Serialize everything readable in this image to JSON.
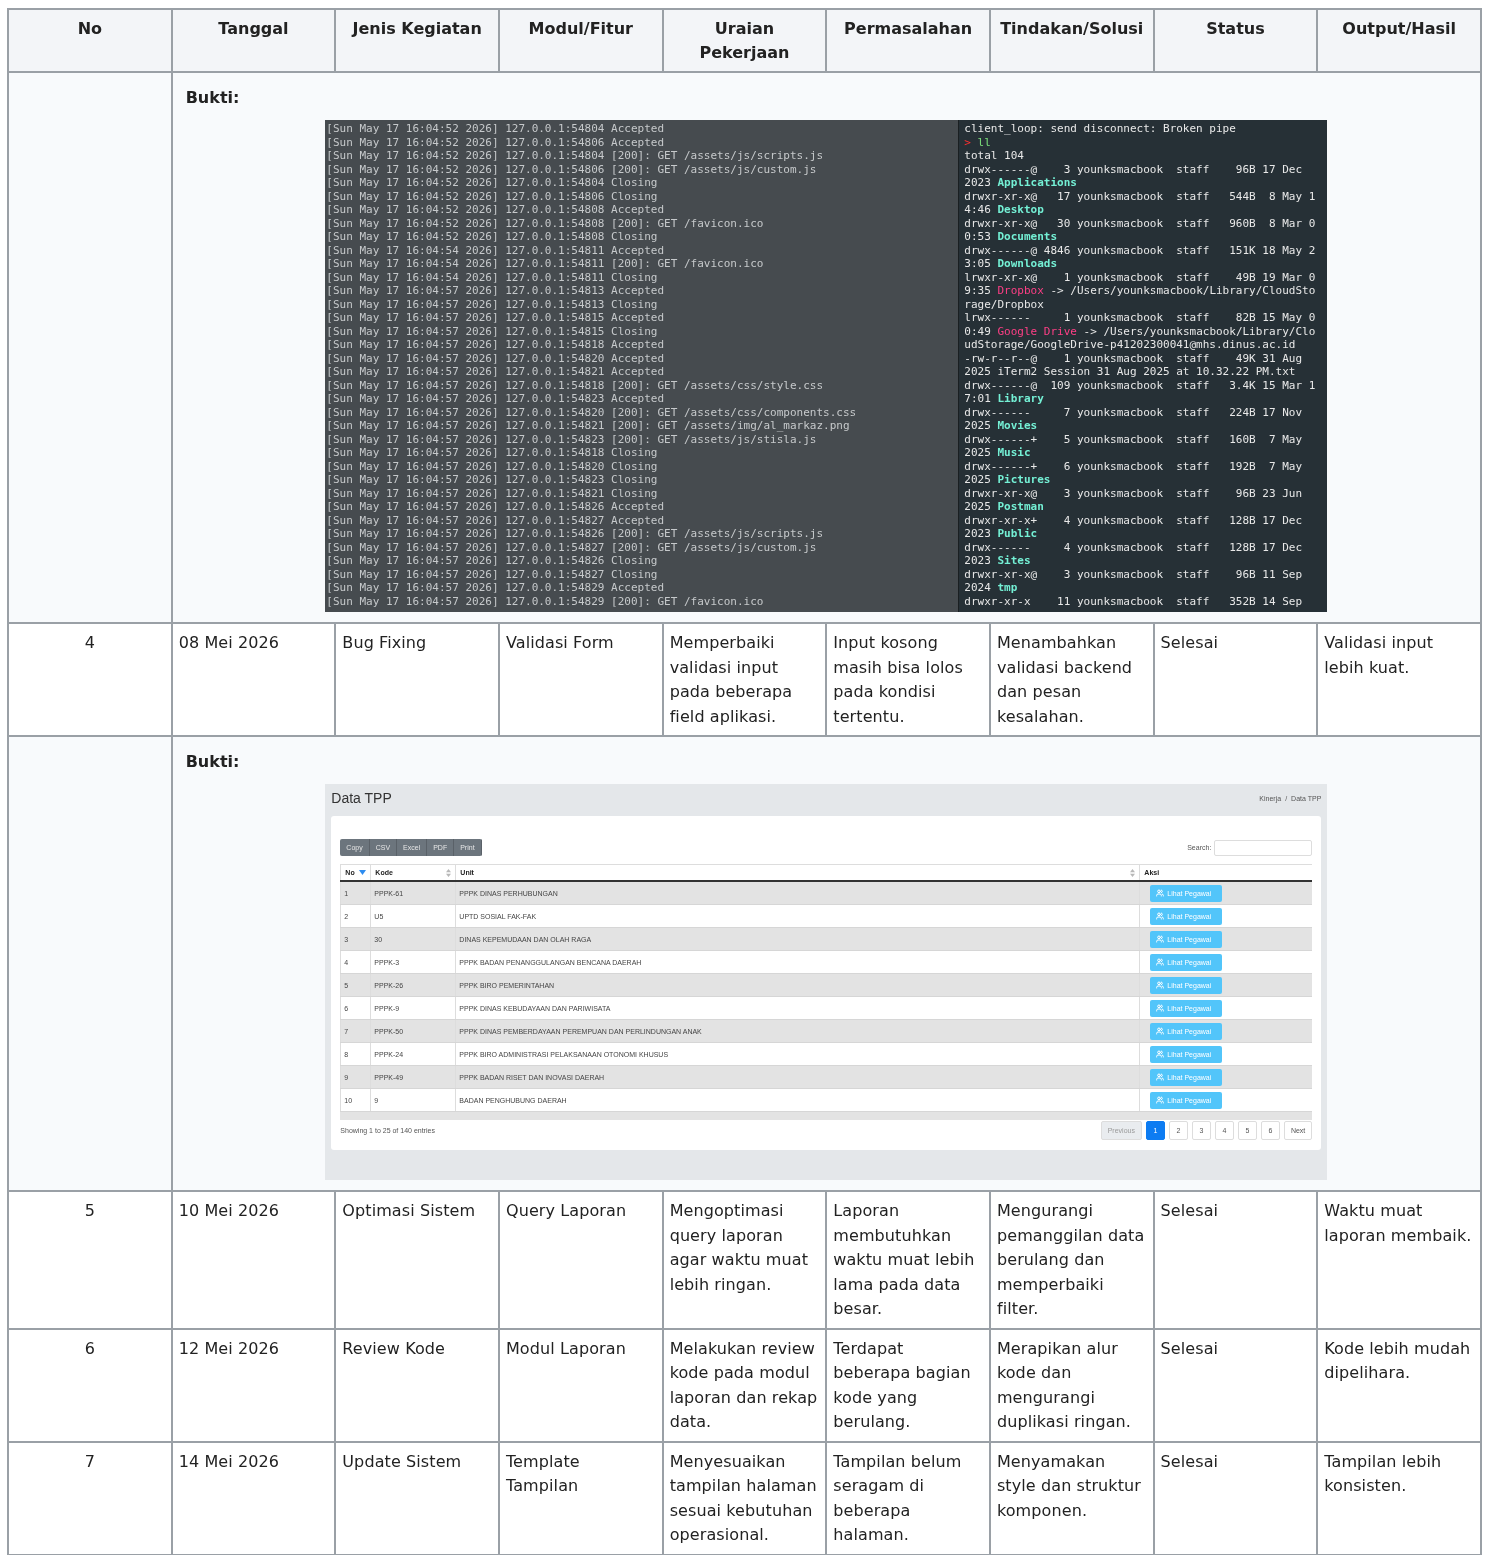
{
  "table": {
    "columns": [
      "No",
      "Tanggal",
      "Jenis Kegiatan",
      "Modul/Fitur",
      "Uraian Pekerjaan",
      "Permasalahan",
      "Tindakan/Solusi",
      "Status",
      "Output/Hasil"
    ],
    "rows": [
      {
        "kind": "evidence",
        "label": "Bukti:",
        "screenshot": {
          "kind": "terminal",
          "left_lines": [
            "[Sun May 17 16:04:52 2026] 127.0.0.1:54804 Accepted",
            "[Sun May 17 16:04:52 2026] 127.0.0.1:54806 Accepted",
            "[Sun May 17 16:04:52 2026] 127.0.0.1:54804 [200]: GET /assets/js/scripts.js",
            "[Sun May 17 16:04:52 2026] 127.0.0.1:54806 [200]: GET /assets/js/custom.js",
            "[Sun May 17 16:04:52 2026] 127.0.0.1:54804 Closing",
            "[Sun May 17 16:04:52 2026] 127.0.0.1:54806 Closing",
            "[Sun May 17 16:04:52 2026] 127.0.0.1:54808 Accepted",
            "[Sun May 17 16:04:52 2026] 127.0.0.1:54808 [200]: GET /favicon.ico",
            "[Sun May 17 16:04:52 2026] 127.0.0.1:54808 Closing",
            "[Sun May 17 16:04:54 2026] 127.0.0.1:54811 Accepted",
            "[Sun May 17 16:04:54 2026] 127.0.0.1:54811 [200]: GET /favicon.ico",
            "[Sun May 17 16:04:54 2026] 127.0.0.1:54811 Closing",
            "[Sun May 17 16:04:57 2026] 127.0.0.1:54813 Accepted",
            "[Sun May 17 16:04:57 2026] 127.0.0.1:54813 Closing",
            "[Sun May 17 16:04:57 2026] 127.0.0.1:54815 Accepted",
            "[Sun May 17 16:04:57 2026] 127.0.0.1:54815 Closing",
            "[Sun May 17 16:04:57 2026] 127.0.0.1:54818 Accepted",
            "[Sun May 17 16:04:57 2026] 127.0.0.1:54820 Accepted",
            "[Sun May 17 16:04:57 2026] 127.0.0.1:54821 Accepted",
            "[Sun May 17 16:04:57 2026] 127.0.0.1:54818 [200]: GET /assets/css/style.css",
            "[Sun May 17 16:04:57 2026] 127.0.0.1:54823 Accepted",
            "[Sun May 17 16:04:57 2026] 127.0.0.1:54820 [200]: GET /assets/css/components.css",
            "[Sun May 17 16:04:57 2026] 127.0.0.1:54821 [200]: GET /assets/img/al_markaz.png",
            "[Sun May 17 16:04:57 2026] 127.0.0.1:54823 [200]: GET /assets/js/stisla.js",
            "[Sun May 17 16:04:57 2026] 127.0.0.1:54818 Closing",
            "[Sun May 17 16:04:57 2026] 127.0.0.1:54820 Closing",
            "[Sun May 17 16:04:57 2026] 127.0.0.1:54823 Closing",
            "[Sun May 17 16:04:57 2026] 127.0.0.1:54821 Closing",
            "[Sun May 17 16:04:57 2026] 127.0.0.1:54826 Accepted",
            "[Sun May 17 16:04:57 2026] 127.0.0.1:54827 Accepted",
            "[Sun May 17 16:04:57 2026] 127.0.0.1:54826 [200]: GET /assets/js/scripts.js",
            "[Sun May 17 16:04:57 2026] 127.0.0.1:54827 [200]: GET /assets/js/custom.js",
            "[Sun May 17 16:04:57 2026] 127.0.0.1:54826 Closing",
            "[Sun May 17 16:04:57 2026] 127.0.0.1:54827 Closing",
            "[Sun May 17 16:04:57 2026] 127.0.0.1:54829 Accepted",
            "[Sun May 17 16:04:57 2026] 127.0.0.1:54829 [200]: GET /favicon.ico"
          ],
          "right_lines": [
            [
              {
                "text": "client_loop: send disconnect: Broken pipe",
                "kind": "plain"
              }
            ],
            [
              {
                "text": "> ",
                "kind": "prompt"
              },
              {
                "text": "ll",
                "kind": "command"
              }
            ],
            [
              {
                "text": "total 104",
                "kind": "plain"
              }
            ],
            [
              {
                "text": "drwx------@    3 younksmacbook  staff    96B 17 Dec",
                "kind": "plain"
              }
            ],
            [
              {
                "text": "2023 ",
                "kind": "plain"
              },
              {
                "text": "Applications",
                "kind": "dir"
              }
            ],
            [
              {
                "text": "drwxr-xr-x@   17 younksmacbook  staff   544B  8 May 1",
                "kind": "plain"
              }
            ],
            [
              {
                "text": "4:46 ",
                "kind": "plain"
              },
              {
                "text": "Desktop",
                "kind": "dir"
              }
            ],
            [
              {
                "text": "drwxr-xr-x@   30 younksmacbook  staff   960B  8 Mar 0",
                "kind": "plain"
              }
            ],
            [
              {
                "text": "0:53 ",
                "kind": "plain"
              },
              {
                "text": "Documents",
                "kind": "dir"
              }
            ],
            [
              {
                "text": "drwx------@ 4846 younksmacbook  staff   151K 18 May 2",
                "kind": "plain"
              }
            ],
            [
              {
                "text": "3:05 ",
                "kind": "plain"
              },
              {
                "text": "Downloads",
                "kind": "dir"
              }
            ],
            [
              {
                "text": "lrwxr-xr-x@    1 younksmacbook  staff    49B 19 Mar 0",
                "kind": "plain"
              }
            ],
            [
              {
                "text": "9:35 ",
                "kind": "plain"
              },
              {
                "text": "Dropbox",
                "kind": "link"
              },
              {
                "text": " -> /Users/younksmacbook/Library/CloudSto",
                "kind": "plain"
              }
            ],
            [
              {
                "text": "rage/Dropbox",
                "kind": "plain"
              }
            ],
            [
              {
                "text": "lrwx------     1 younksmacbook  staff    82B 15 May 0",
                "kind": "plain"
              }
            ],
            [
              {
                "text": "0:49 ",
                "kind": "plain"
              },
              {
                "text": "Google Drive",
                "kind": "link"
              },
              {
                "text": " -> /Users/younksmacbook/Library/Clo",
                "kind": "plain"
              }
            ],
            [
              {
                "text": "udStorage/GoogleDrive-p41202300041@mhs.dinus.ac.id",
                "kind": "plain"
              }
            ],
            [
              {
                "text": "-rw-r--r--@    1 younksmacbook  staff    49K 31 Aug",
                "kind": "plain"
              }
            ],
            [
              {
                "text": "2025 iTerm2 Session 31 Aug 2025 at 10.32.22 PM.txt",
                "kind": "plain"
              }
            ],
            [
              {
                "text": "drwx------@  109 younksmacbook  staff   3.4K 15 Mar 1",
                "kind": "plain"
              }
            ],
            [
              {
                "text": "7:01 ",
                "kind": "plain"
              },
              {
                "text": "Library",
                "kind": "dir"
              }
            ],
            [
              {
                "text": "drwx------     7 younksmacbook  staff   224B 17 Nov",
                "kind": "plain"
              }
            ],
            [
              {
                "text": "2025 ",
                "kind": "plain"
              },
              {
                "text": "Movies",
                "kind": "dir"
              }
            ],
            [
              {
                "text": "drwx------+    5 younksmacbook  staff   160B  7 May",
                "kind": "plain"
              }
            ],
            [
              {
                "text": "2025 ",
                "kind": "plain"
              },
              {
                "text": "Music",
                "kind": "dir"
              }
            ],
            [
              {
                "text": "drwx------+    6 younksmacbook  staff   192B  7 May",
                "kind": "plain"
              }
            ],
            [
              {
                "text": "2025 ",
                "kind": "plain"
              },
              {
                "text": "Pictures",
                "kind": "dir"
              }
            ],
            [
              {
                "text": "drwxr-xr-x@    3 younksmacbook  staff    96B 23 Jun",
                "kind": "plain"
              }
            ],
            [
              {
                "text": "2025 ",
                "kind": "plain"
              },
              {
                "text": "Postman",
                "kind": "dir"
              }
            ],
            [
              {
                "text": "drwxr-xr-x+    4 younksmacbook  staff   128B 17 Dec",
                "kind": "plain"
              }
            ],
            [
              {
                "text": "2023 ",
                "kind": "plain"
              },
              {
                "text": "Public",
                "kind": "dir"
              }
            ],
            [
              {
                "text": "drwx------     4 younksmacbook  staff   128B 17 Dec",
                "kind": "plain"
              }
            ],
            [
              {
                "text": "2023 ",
                "kind": "plain"
              },
              {
                "text": "Sites",
                "kind": "dir"
              }
            ],
            [
              {
                "text": "drwxr-xr-x@    3 younksmacbook  staff    96B 11 Sep",
                "kind": "plain"
              }
            ],
            [
              {
                "text": "2024 ",
                "kind": "plain"
              },
              {
                "text": "tmp",
                "kind": "dir"
              }
            ],
            [
              {
                "text": "drwxr-xr-x    11 younksmacbook  staff   352B 14 Sep",
                "kind": "plain"
              }
            ]
          ]
        }
      },
      {
        "kind": "entry",
        "cells": [
          "4",
          "08 Mei 2026",
          "Bug Fixing",
          "Validasi Form",
          "Memperbaiki validasi input pada beberapa field aplikasi.",
          "Input kosong masih bisa lolos pada kondisi tertentu.",
          "Menambahkan validasi backend dan pesan kesalahan.",
          "Selesai",
          "Validasi input lebih kuat."
        ]
      },
      {
        "kind": "evidence",
        "label": "Bukti:",
        "screenshot": {
          "kind": "data_table",
          "title": "Data TPP",
          "breadcrumb": [
            "Kinerja",
            "Data TPP"
          ],
          "breadcrumb_separator": "/",
          "export_buttons": [
            "Copy",
            "CSV",
            "Excel",
            "PDF",
            "Print"
          ],
          "search_label": "Search:",
          "columns": [
            {
              "label": "No",
              "sortable": true,
              "sorted": true
            },
            {
              "label": "Kode",
              "sortable": true,
              "sorted": false
            },
            {
              "label": "Unit",
              "sortable": true,
              "sorted": false
            },
            {
              "label": "Aksi",
              "sortable": false
            }
          ],
          "rows": [
            {
              "no": "1",
              "kode": "PPPK-61",
              "unit": "PPPK DINAS PERHUBUNGAN",
              "action": "Lihat Pegawai"
            },
            {
              "no": "2",
              "kode": "U5",
              "unit": "UPTD SOSIAL FAK-FAK",
              "action": "Lihat Pegawai"
            },
            {
              "no": "3",
              "kode": "30",
              "unit": "DINAS KEPEMUDAAN DAN OLAH RAGA",
              "action": "Lihat Pegawai"
            },
            {
              "no": "4",
              "kode": "PPPK-3",
              "unit": "PPPK BADAN PENANGGULANGAN BENCANA DAERAH",
              "action": "Lihat Pegawai"
            },
            {
              "no": "5",
              "kode": "PPPK-26",
              "unit": "PPPK BIRO PEMERINTAHAN",
              "action": "Lihat Pegawai"
            },
            {
              "no": "6",
              "kode": "PPPK-9",
              "unit": "PPPK DINAS KEBUDAYAAN DAN PARIWISATA",
              "action": "Lihat Pegawai"
            },
            {
              "no": "7",
              "kode": "PPPK-50",
              "unit": "PPPK DINAS PEMBERDAYAAN PEREMPUAN DAN PERLINDUNGAN ANAK",
              "action": "Lihat Pegawai"
            },
            {
              "no": "8",
              "kode": "PPPK-24",
              "unit": "PPPK BIRO ADMINISTRASI PELAKSANAAN OTONOMI KHUSUS",
              "action": "Lihat Pegawai"
            },
            {
              "no": "9",
              "kode": "PPPK-49",
              "unit": "PPPK BADAN RISET DAN INOVASI DAERAH",
              "action": "Lihat Pegawai"
            },
            {
              "no": "10",
              "kode": "9",
              "unit": "BADAN PENGHUBUNG DAERAH",
              "action": "Lihat Pegawai"
            }
          ],
          "info": "Showing 1 to 25 of 140 entries",
          "pagination": [
            {
              "label": "Previous",
              "selected": false,
              "disabled": true
            },
            {
              "label": "1",
              "selected": true,
              "disabled": false
            },
            {
              "label": "2",
              "selected": false,
              "disabled": false
            },
            {
              "label": "3",
              "selected": false,
              "disabled": false
            },
            {
              "label": "4",
              "selected": false,
              "disabled": false
            },
            {
              "label": "5",
              "selected": false,
              "disabled": false
            },
            {
              "label": "6",
              "selected": false,
              "disabled": false
            },
            {
              "label": "Next",
              "selected": false,
              "disabled": false
            }
          ]
        }
      },
      {
        "kind": "entry",
        "cells": [
          "5",
          "10 Mei 2026",
          "Optimasi Sistem",
          "Query Laporan",
          "Mengoptimasi query laporan agar waktu muat lebih ringan.",
          "Laporan membutuhkan waktu muat lebih lama pada data besar.",
          "Mengurangi pemanggilan data berulang dan memperbaiki filter.",
          "Selesai",
          "Waktu muat laporan membaik."
        ]
      },
      {
        "kind": "entry",
        "cells": [
          "6",
          "12 Mei 2026",
          "Review Kode",
          "Modul Laporan",
          "Melakukan review kode pada modul laporan dan rekap data.",
          "Terdapat beberapa bagian kode yang berulang.",
          "Merapikan alur kode dan mengurangi duplikasi ringan.",
          "Selesai",
          "Kode lebih mudah dipelihara."
        ]
      },
      {
        "kind": "entry",
        "cells": [
          "7",
          "14 Mei 2026",
          "Update Sistem",
          "Template Tampilan",
          "Menyesuaikan tampilan halaman sesuai kebutuhan operasional.",
          "Tampilan belum seragam di beberapa halaman.",
          "Menyamakan style dan struktur komponen.",
          "Selesai",
          "Tampilan lebih konsisten."
        ]
      }
    ]
  }
}
